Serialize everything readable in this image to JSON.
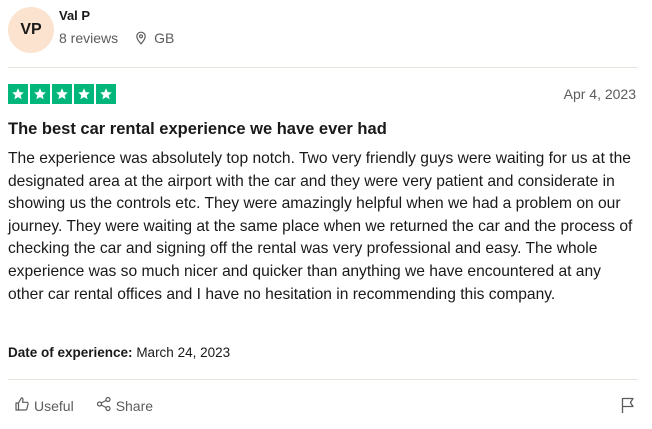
{
  "reviewer": {
    "initials": "VP",
    "name": "Val P",
    "reviews_count": "8 reviews",
    "country": "GB",
    "avatar_color": "#fbe3cf"
  },
  "review": {
    "rating": 5,
    "rating_max": 5,
    "star_color": "#00b67a",
    "date": "Apr 4, 2023",
    "title": "The best car rental experience we have ever had",
    "text": "The experience was absolutely top notch. Two very friendly guys were waiting for us at the designated area at the airport with the car and they were very patient and considerate in showing us the controls etc. They were amazingly helpful when we had a problem on our journey. They were waiting at the same place when we returned the car and the process of checking the car and signing off the rental was very professional and easy. The whole experience was so much nicer and quicker than anything we have encountered at any other car rental offices and I have no hesitation in recommending this company.",
    "experience_label": "Date of experience:",
    "experience_date": "March 24, 2023"
  },
  "actions": {
    "useful_label": "Useful",
    "share_label": "Share",
    "useful_icon": "thumbs-up-icon",
    "share_icon": "share-icon",
    "report_icon": "flag-icon"
  }
}
